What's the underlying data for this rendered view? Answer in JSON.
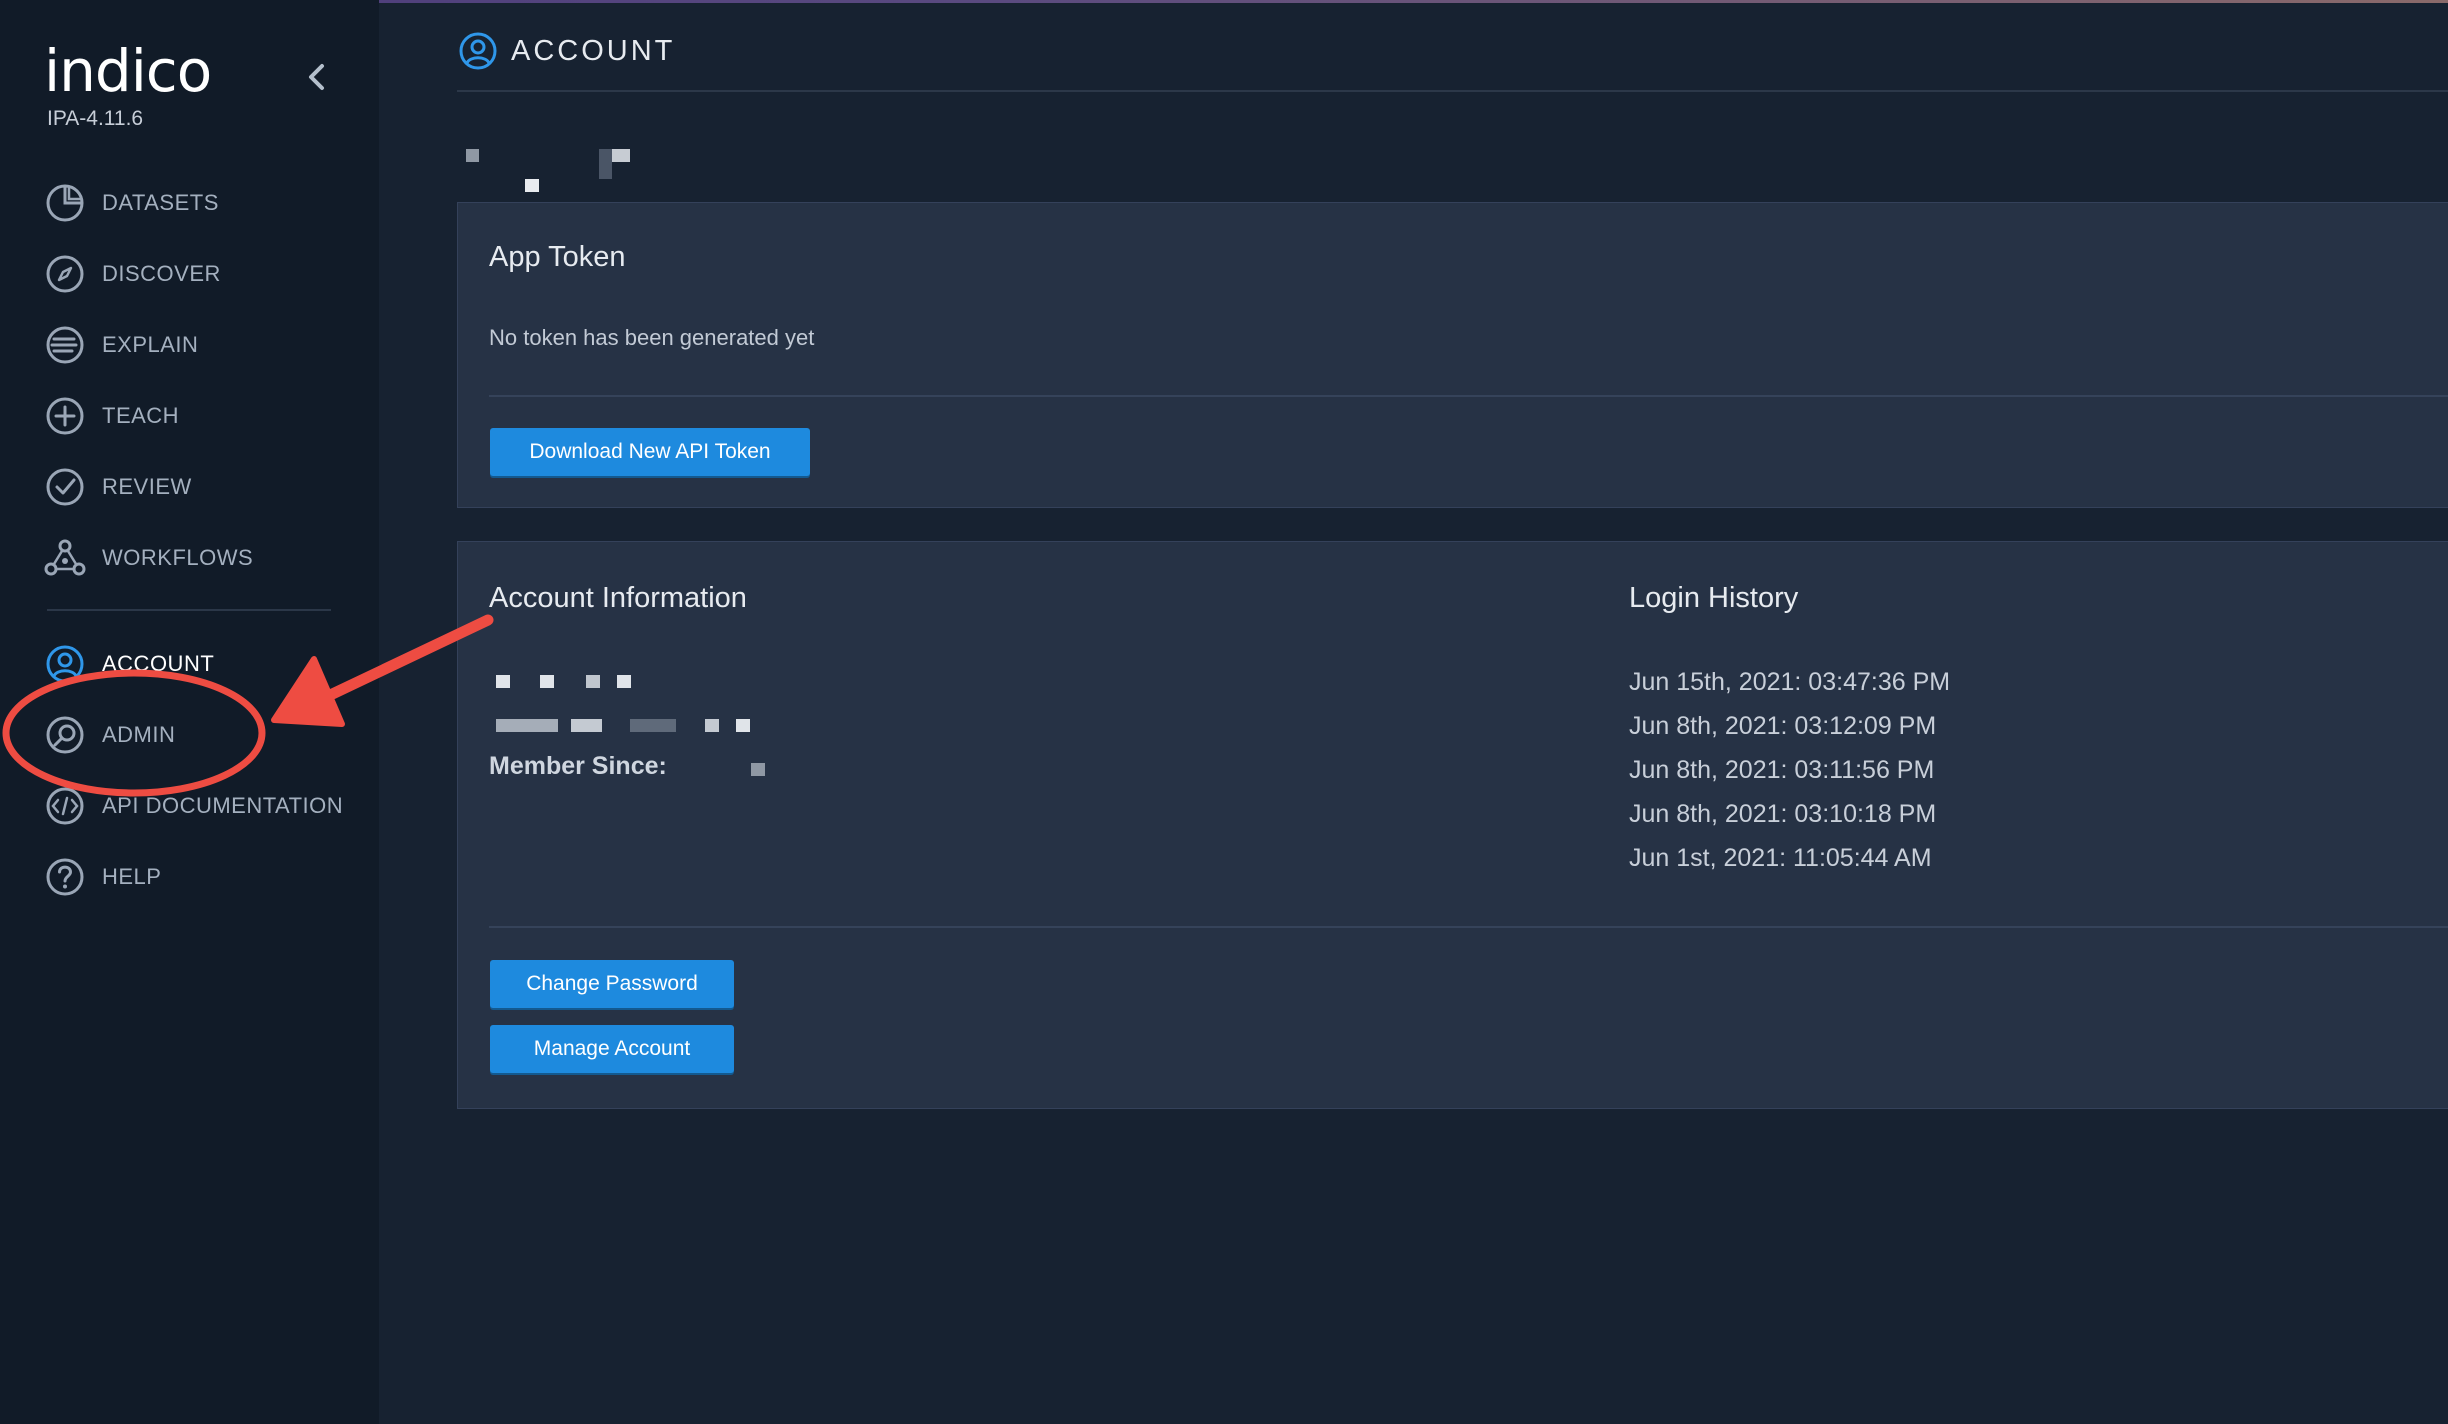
{
  "app": {
    "logo": "indico",
    "version": "IPA-4.11.6"
  },
  "sidebar": {
    "items": [
      {
        "label": "DATASETS",
        "icon": "pie-chart-icon"
      },
      {
        "label": "DISCOVER",
        "icon": "compass-icon"
      },
      {
        "label": "EXPLAIN",
        "icon": "lines-icon"
      },
      {
        "label": "TEACH",
        "icon": "plus-circle-icon"
      },
      {
        "label": "REVIEW",
        "icon": "check-circle-icon"
      },
      {
        "label": "WORKFLOWS",
        "icon": "network-icon"
      }
    ],
    "secondary": [
      {
        "label": "ACCOUNT",
        "icon": "user-circle-icon",
        "active": true
      },
      {
        "label": "ADMIN",
        "icon": "search-circle-icon"
      },
      {
        "label": "API DOCUMENTATION",
        "icon": "code-icon"
      },
      {
        "label": "HELP",
        "icon": "help-icon"
      }
    ]
  },
  "header": {
    "title": "ACCOUNT",
    "icon": "user-circle-icon"
  },
  "app_token": {
    "title": "App Token",
    "status": "No token has been generated yet",
    "button": "Download New API Token"
  },
  "account_info": {
    "title": "Account Information",
    "member_since_label": "Member Since:",
    "change_password": "Change Password",
    "manage_account": "Manage Account"
  },
  "login_history": {
    "title": "Login History",
    "entries": [
      "Jun 15th, 2021: 03:47:36 PM",
      "Jun 8th, 2021: 03:12:09 PM",
      "Jun 8th, 2021: 03:11:56 PM",
      "Jun 8th, 2021: 03:10:18 PM",
      "Jun 1st, 2021: 11:05:44 AM"
    ]
  },
  "colors": {
    "background": "#172231",
    "sidebar": "#111b28",
    "card": "#263245",
    "accent": "#1e8ade",
    "annotation": "#ee4c42"
  }
}
